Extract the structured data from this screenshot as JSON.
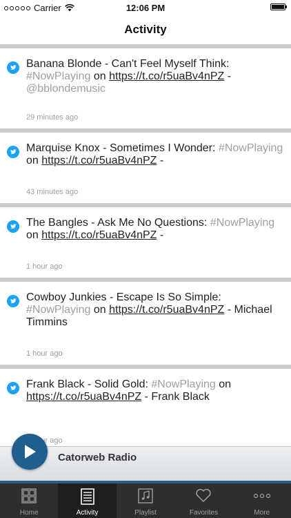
{
  "status_bar": {
    "carrier": "Carrier",
    "time": "12:06 PM"
  },
  "nav": {
    "title": "Activity"
  },
  "feed": [
    {
      "text": "Banana Blonde - Can't Feel Myself Think:",
      "hashtag": "#NowPlaying",
      "on": "on",
      "link": "https://t.co/r5uaBv4nPZ",
      "suffix": "-",
      "handle": "@bblondemusic",
      "time": "29 minutes ago",
      "icon": "twitter-icon"
    },
    {
      "text": "Marquise Knox - Sometimes I Wonder:",
      "hashtag": "#NowPlaying",
      "on": "on",
      "link": "https://t.co/r5uaBv4nPZ",
      "suffix": "-",
      "time": "43 minutes ago",
      "icon": "twitter-icon"
    },
    {
      "text": "The Bangles - Ask Me No Questions:",
      "hashtag": "#NowPlaying",
      "on": "on",
      "link": "https://t.co/r5uaBv4nPZ",
      "suffix": "-",
      "time": "1 hour ago",
      "icon": "twitter-icon"
    },
    {
      "text": "Cowboy Junkies - Escape Is So Simple:",
      "hashtag": "#NowPlaying",
      "on": "on",
      "link": "https://t.co/r5uaBv4nPZ",
      "suffix": "- Michael Timmins",
      "time": "1 hour ago",
      "icon": "twitter-icon"
    },
    {
      "text": "Frank Black - Solid Gold:",
      "hashtag": "#NowPlaying",
      "on": "on",
      "link": "https://t.co/r5uaBv4nPZ",
      "suffix": "- Frank Black",
      "time": "1 hour ago",
      "icon": "twitter-icon"
    }
  ],
  "player": {
    "station": "Catorweb Radio",
    "icon": "play-icon"
  },
  "tabs": [
    {
      "label": "Home",
      "icon": "home-grid-icon"
    },
    {
      "label": "Activity",
      "icon": "activity-list-icon"
    },
    {
      "label": "Playlist",
      "icon": "playlist-music-icon"
    },
    {
      "label": "Favorites",
      "icon": "heart-icon"
    },
    {
      "label": "More",
      "icon": "more-dots-icon"
    }
  ],
  "colors": {
    "accent": "#1f5f8f",
    "twitter": "#1da1f2",
    "tab_bar": "#2e2e2e",
    "separator": "#c9cdd2"
  }
}
